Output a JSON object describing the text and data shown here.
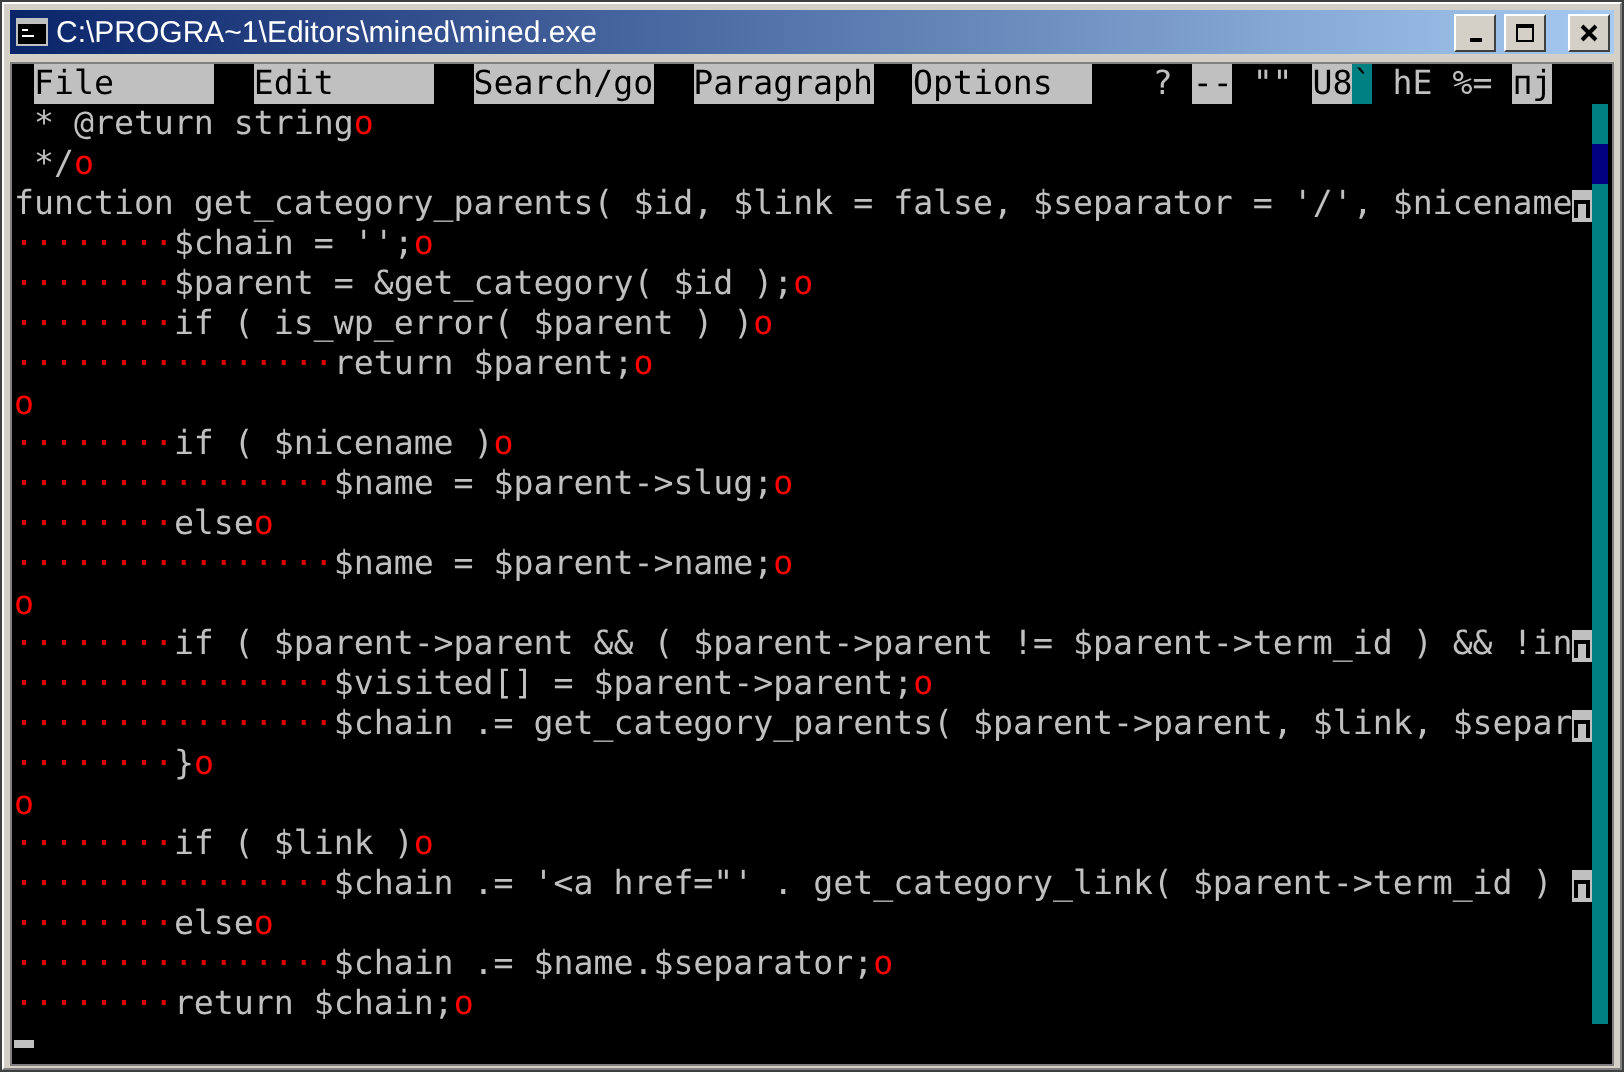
{
  "window": {
    "title": "C:\\PROGRA~1\\Editors\\mined\\mined.exe"
  },
  "menu": [
    "File",
    "Edit",
    "Search/go",
    "Paragraph",
    "Options"
  ],
  "status": [
    {
      "text": "?",
      "kind": "plain"
    },
    {
      "text": "--",
      "kind": "highlight"
    },
    {
      "text": "\"\"",
      "kind": "plain"
    },
    {
      "text": "U8",
      "kind": "highlight"
    },
    {
      "text": "`",
      "kind": "accent"
    },
    {
      "text": "hE",
      "kind": "plain"
    },
    {
      "text": "%=",
      "kind": "plain"
    },
    {
      "text": "пj",
      "kind": "highlight"
    }
  ],
  "lines": [
    {
      "text": " * @return string",
      "kind": "newline",
      "end_mark": "o"
    },
    {
      "text": " */",
      "kind": "newline",
      "end_mark": "o"
    },
    {
      "text": "function get_category_parents( $id, $link = false, $separator = '/', $nicename",
      "kind": "continued"
    },
    {
      "indent": "········",
      "text": "$chain = '';",
      "kind": "newline",
      "end_mark": "o"
    },
    {
      "indent": "········",
      "text": "$parent = &get_category( $id );",
      "kind": "newline",
      "end_mark": "o"
    },
    {
      "indent": "········",
      "text": "if ( is_wp_error( $parent ) )",
      "kind": "newline",
      "end_mark": "o"
    },
    {
      "indent": "················",
      "text": "return $parent;",
      "kind": "newline",
      "end_mark": "o"
    },
    {
      "kind": "newline",
      "end_mark": "o"
    },
    {
      "indent": "········",
      "text": "if ( $nicename )",
      "kind": "newline",
      "end_mark": "o"
    },
    {
      "indent": "················",
      "text": "$name = $parent->slug;",
      "kind": "newline",
      "end_mark": "o"
    },
    {
      "indent": "········",
      "text": "else",
      "kind": "newline",
      "end_mark": "o"
    },
    {
      "indent": "················",
      "text": "$name = $parent->name;",
      "kind": "newline",
      "end_mark": "o"
    },
    {
      "kind": "newline",
      "end_mark": "o"
    },
    {
      "indent": "········",
      "text": "if ( $parent->parent && ( $parent->parent != $parent->term_id ) && !in",
      "kind": "continued"
    },
    {
      "indent": "················",
      "text": "$visited[] = $parent->parent;",
      "kind": "newline",
      "end_mark": "o"
    },
    {
      "indent": "················",
      "text": "$chain .= get_category_parents( $parent->parent, $link, $separ",
      "kind": "continued"
    },
    {
      "indent": "········",
      "text": "}",
      "kind": "newline",
      "end_mark": "o"
    },
    {
      "kind": "newline",
      "end_mark": "o"
    },
    {
      "indent": "········",
      "text": "if ( $link )",
      "kind": "newline",
      "end_mark": "o"
    },
    {
      "indent": "················",
      "text": "$chain .= '<a href=\"' . get_category_link( $parent->term_id ) ",
      "kind": "continued"
    },
    {
      "indent": "········",
      "text": "else",
      "kind": "newline",
      "end_mark": "o"
    },
    {
      "indent": "················",
      "text": "$chain .= $name.$separator;",
      "kind": "newline",
      "end_mark": "o"
    },
    {
      "indent": "········",
      "text": "return $chain;",
      "kind": "newline",
      "end_mark": "o"
    }
  ]
}
